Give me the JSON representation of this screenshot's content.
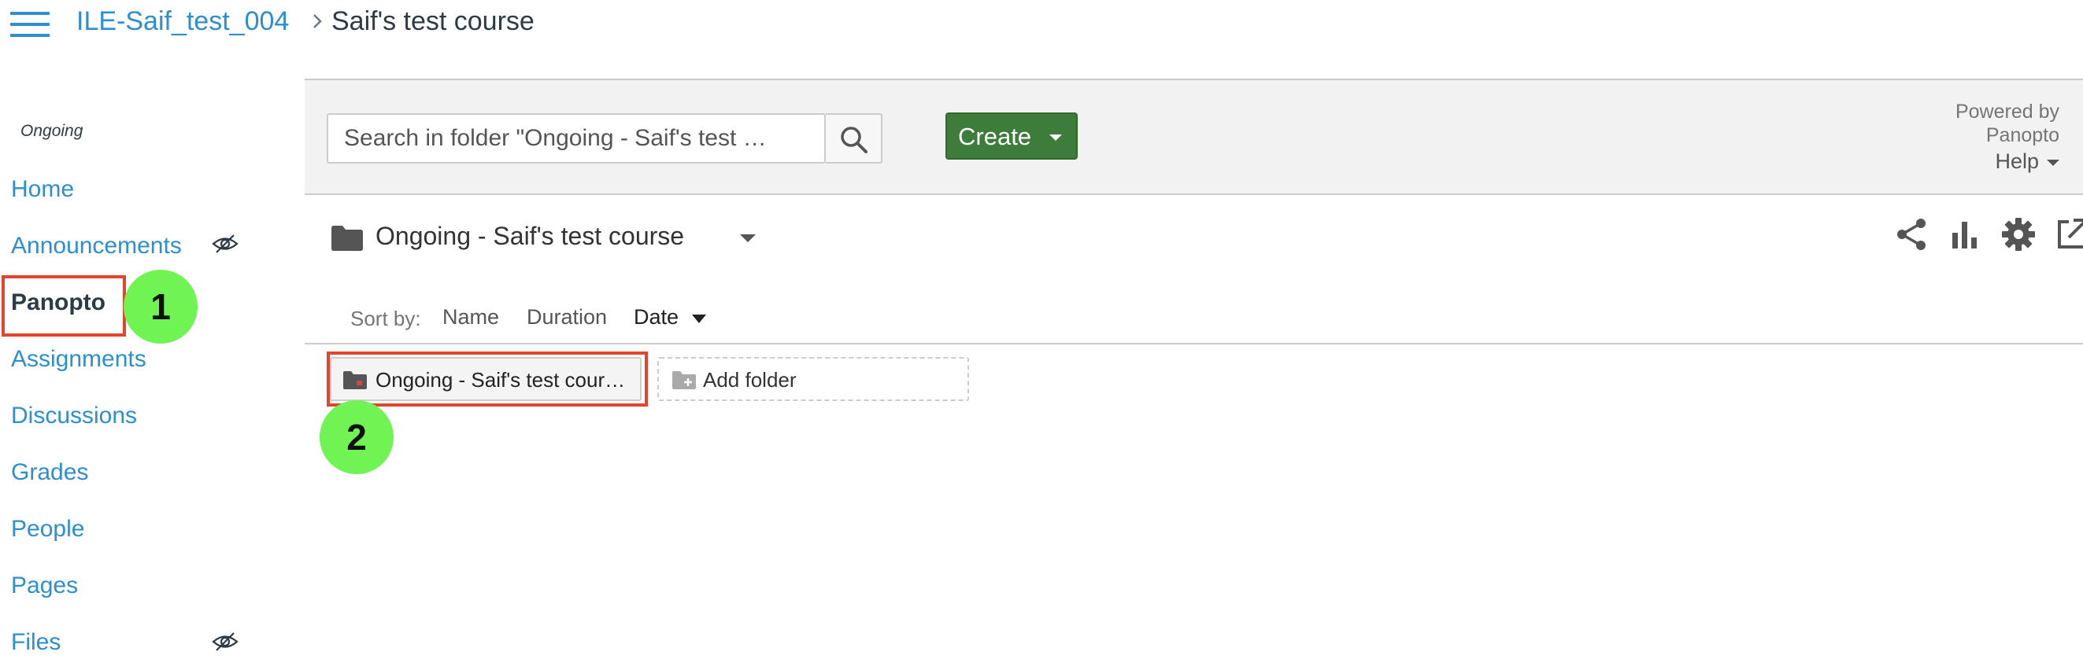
{
  "header": {
    "course_link": "ILE-Saif_test_004",
    "current_page": "Saif's test course"
  },
  "sidebar": {
    "term": "Ongoing",
    "items": [
      {
        "label": "Home"
      },
      {
        "label": "Announcements"
      },
      {
        "label": "Panopto"
      },
      {
        "label": "Assignments"
      },
      {
        "label": "Discussions"
      },
      {
        "label": "Grades"
      },
      {
        "label": "People"
      },
      {
        "label": "Pages"
      },
      {
        "label": "Files"
      }
    ],
    "active_item": "Panopto"
  },
  "annotations": {
    "step_1": "1",
    "step_2": "2",
    "highlight_color": "#e2452d",
    "badge_color": "#6ff454"
  },
  "panopto": {
    "search_placeholder": "Search in folder \"Ongoing - Saif's test …",
    "create_label": "Create",
    "powered_by": "Powered by Panopto",
    "help_label": "Help",
    "folder_title": "Ongoing - Saif's test course",
    "sort": {
      "label": "Sort by:",
      "options": [
        "Name",
        "Duration",
        "Date"
      ],
      "active": "Date"
    },
    "subfolder_label": "Ongoing - Saif's test cour…",
    "add_folder_label": "Add folder",
    "accent_color": "#3d7c3a",
    "link_color": "#2d8ed0"
  }
}
